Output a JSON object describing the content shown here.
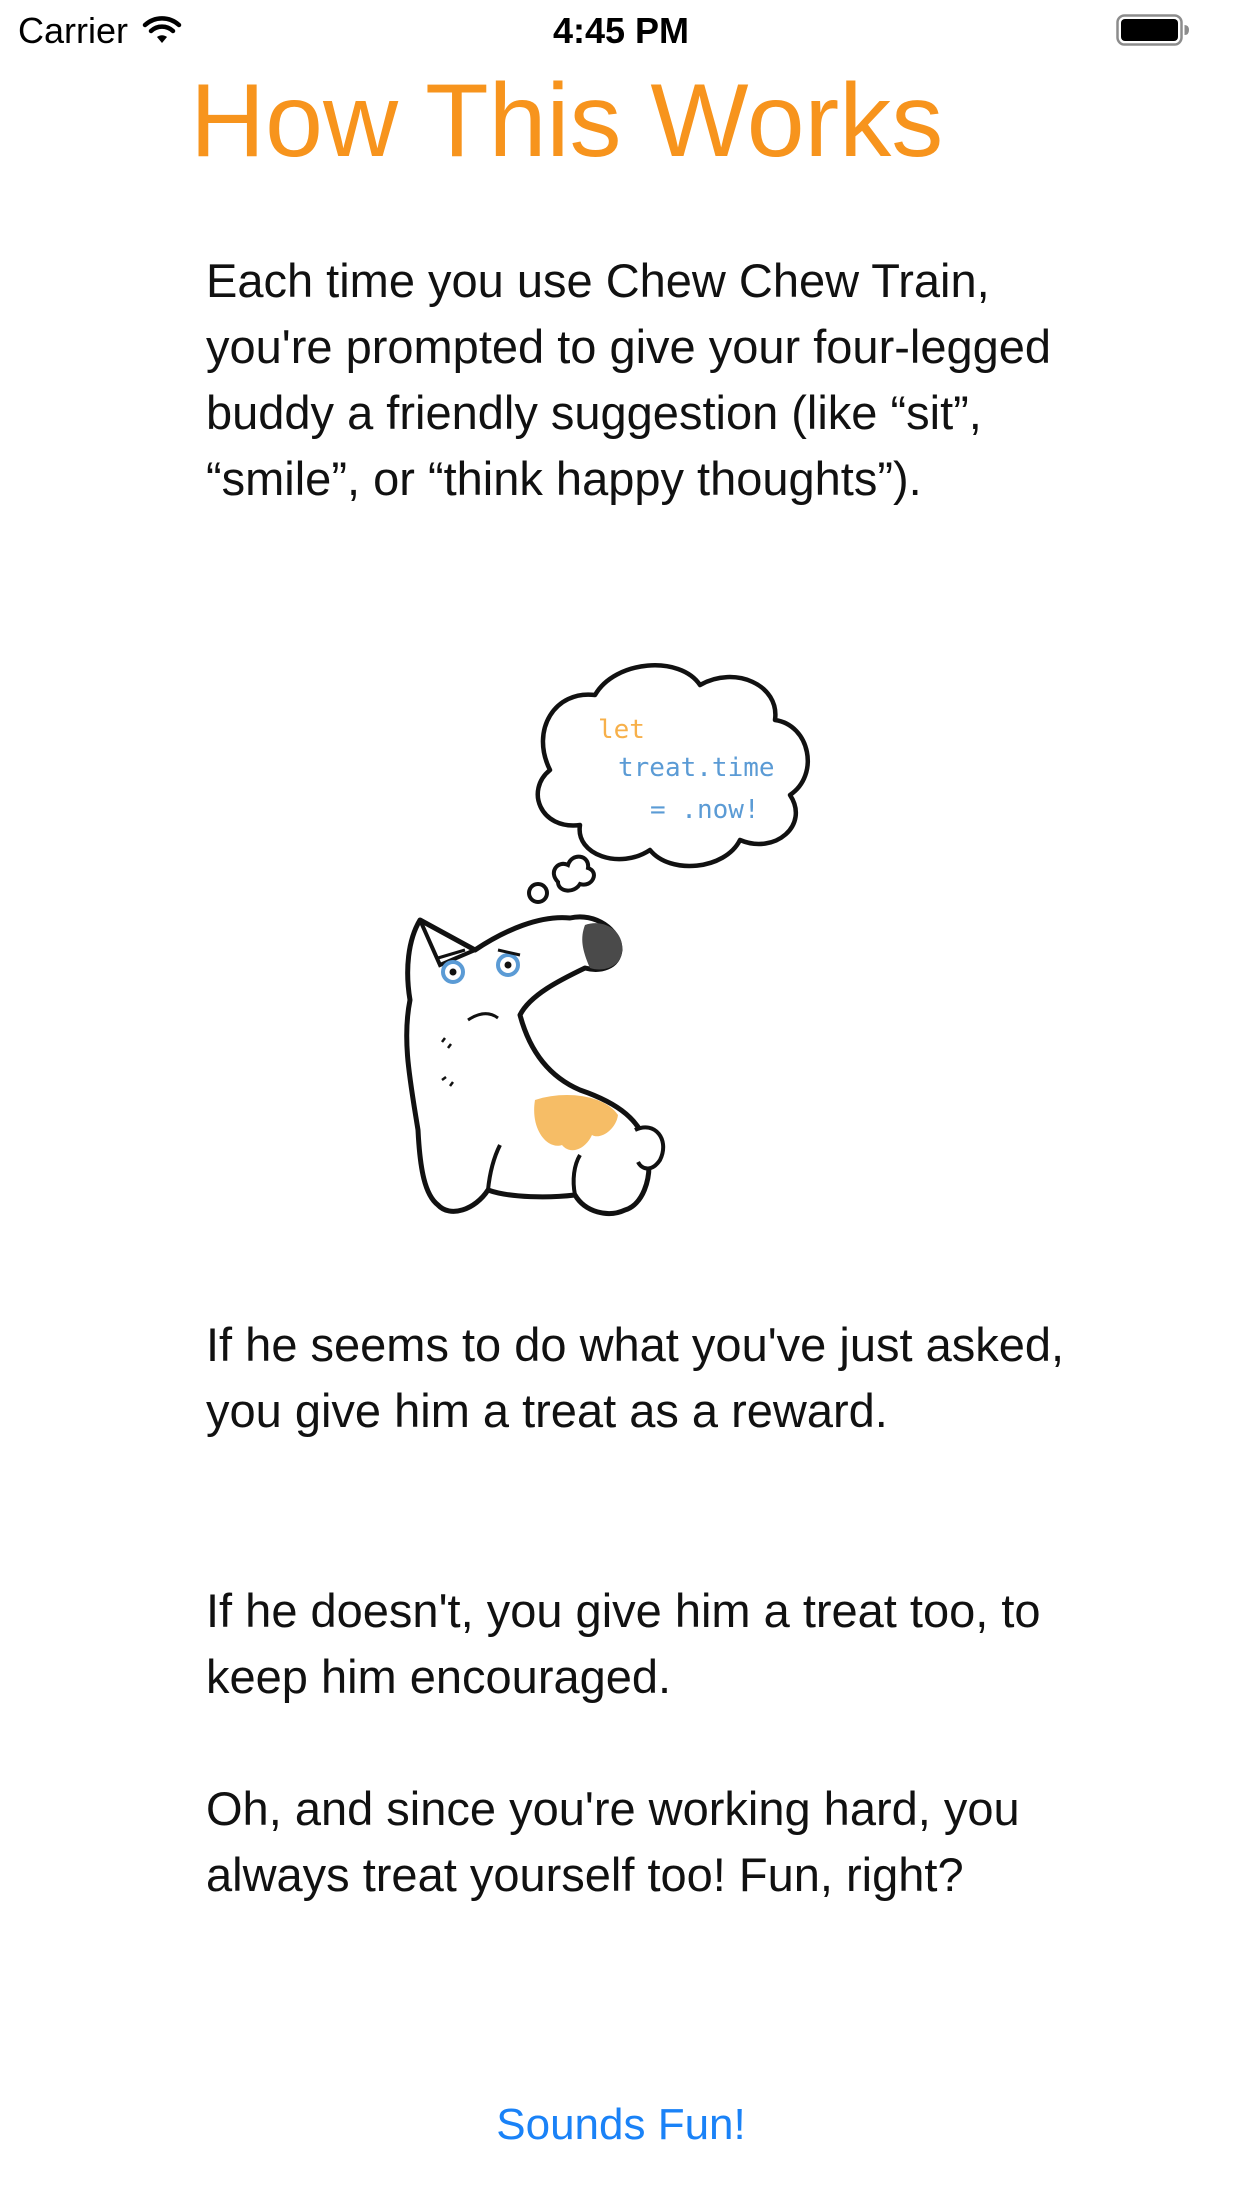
{
  "status_bar": {
    "carrier": "Carrier",
    "time": "4:45 PM"
  },
  "title": "How This Works",
  "paragraphs": [
    "Each time you use Chew Chew Train, you're prompted  to give your four-legged buddy a friendly suggestion (like “sit”, “smile”, or “think happy thoughts”).",
    "If he seems to do what you've just asked, you give him a treat as a reward.",
    "If he doesn't, you give him a treat too, to keep him encouraged.",
    "Oh, and since you're working hard, you always treat yourself too! Fun, right?"
  ],
  "illustration": {
    "code_keyword": "let",
    "code_line_2": "treat.time",
    "code_line_3": "= .now!"
  },
  "button_label": "Sounds Fun!",
  "colors": {
    "title": "#f7941d",
    "link": "#1a82f7",
    "code_keyword": "#f7b04a",
    "code_text": "#5b9bd5",
    "dog_patch": "#f6bd66"
  }
}
